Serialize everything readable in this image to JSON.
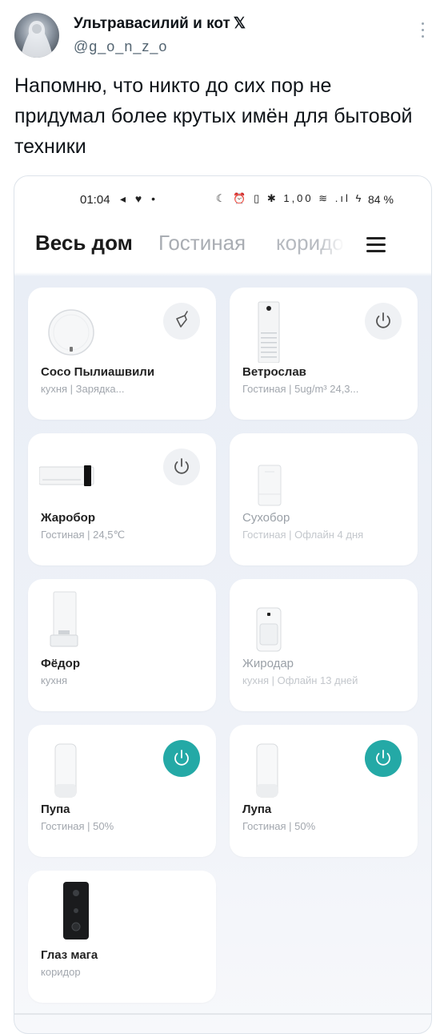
{
  "tweet": {
    "author_name": "Ультравасилий и кот",
    "verified_mark": "𝕏",
    "handle": "@g_o_n_z_o",
    "text": "Напомню, что никто до сих пор не придумал более крутых имён для бытовой техники"
  },
  "phone": {
    "status_bar": {
      "time": "01:04",
      "left_icons": "◂ ♥ •",
      "right_icons": "☾ ⏰ ▯ ✱ 1,00 ≋ .ıl ϟ",
      "battery": "84 %"
    },
    "tabs": [
      {
        "label": "Весь дом",
        "active": true
      },
      {
        "label": "Гостиная",
        "active": false
      },
      {
        "label": "коридор",
        "active": false
      }
    ],
    "menu_icon": "hamburger-menu-icon",
    "accent_color": "#24a9a6",
    "devices": [
      {
        "name": "Coco Пылиашвили",
        "subtitle": "кухня | Зарядка...",
        "icon": "robot-vacuum",
        "control": "broom-icon",
        "control_on": false,
        "offline": false
      },
      {
        "name": "Ветрослав",
        "subtitle": "Гостиная | 5ug/m³ 24,3...",
        "icon": "air-purifier",
        "control": "power-icon",
        "control_on": false,
        "offline": false
      },
      {
        "name": "Жаробор",
        "subtitle": "Гостиная | 24,5℃",
        "icon": "air-conditioner",
        "control": "power-icon",
        "control_on": false,
        "offline": false
      },
      {
        "name": "Сухобор",
        "subtitle": "Гостиная | Офлайн 4 дня",
        "icon": "humidifier",
        "control": null,
        "control_on": false,
        "offline": true
      },
      {
        "name": "Фёдор",
        "subtitle": "кухня",
        "icon": "water-dispenser",
        "control": null,
        "control_on": false,
        "offline": false
      },
      {
        "name": "Жиродар",
        "subtitle": "кухня | Офлайн 13 дней",
        "icon": "air-fryer",
        "control": null,
        "control_on": false,
        "offline": true
      },
      {
        "name": "Пупа",
        "subtitle": "Гостиная | 50%",
        "icon": "night-lamp",
        "control": "power-icon",
        "control_on": true,
        "offline": false
      },
      {
        "name": "Лупа",
        "subtitle": "Гостиная | 50%",
        "icon": "night-lamp",
        "control": "power-icon",
        "control_on": true,
        "offline": false
      },
      {
        "name": "Глаз мага",
        "subtitle": "коридор",
        "icon": "video-doorbell",
        "control": null,
        "control_on": false,
        "offline": false
      }
    ]
  }
}
